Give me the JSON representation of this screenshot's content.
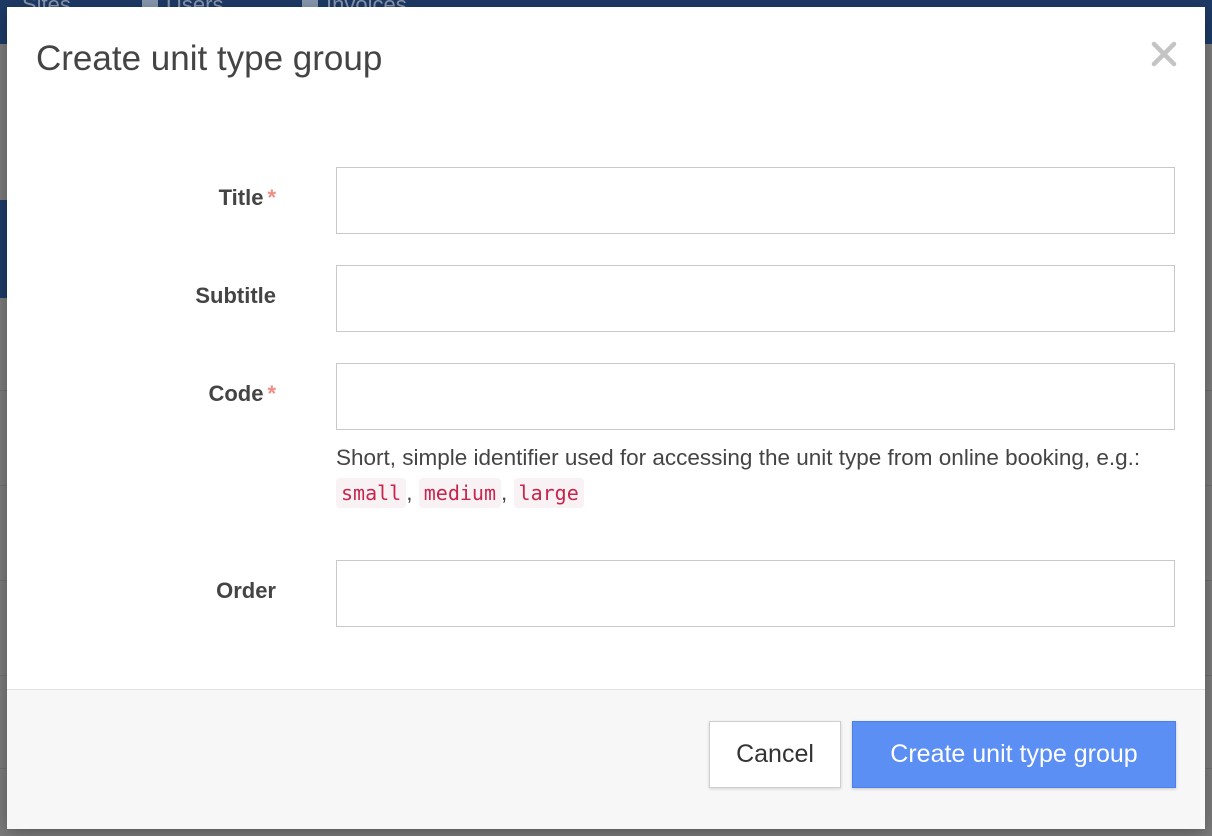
{
  "background": {
    "tabs": [
      "Sites",
      "Users",
      "Invoices"
    ]
  },
  "modal": {
    "title": "Create unit type group",
    "close_icon": "close-icon",
    "fields": {
      "title": {
        "label": "Title",
        "required_marker": "*",
        "value": ""
      },
      "subtitle": {
        "label": "Subtitle",
        "value": ""
      },
      "code": {
        "label": "Code",
        "required_marker": "*",
        "value": "",
        "help_text": "Short, simple identifier used for accessing the unit type from online booking, e.g.:",
        "examples": [
          "small",
          "medium",
          "large"
        ],
        "separator": ","
      },
      "order": {
        "label": "Order",
        "value": ""
      }
    },
    "footer": {
      "cancel_label": "Cancel",
      "create_label": "Create unit type group"
    }
  },
  "colors": {
    "primary_button": "#5b8ff4",
    "required_star": "#ef8d84",
    "code_text": "#c7254e",
    "code_bg": "#f9f2f4",
    "app_header": "#1d3a66"
  }
}
